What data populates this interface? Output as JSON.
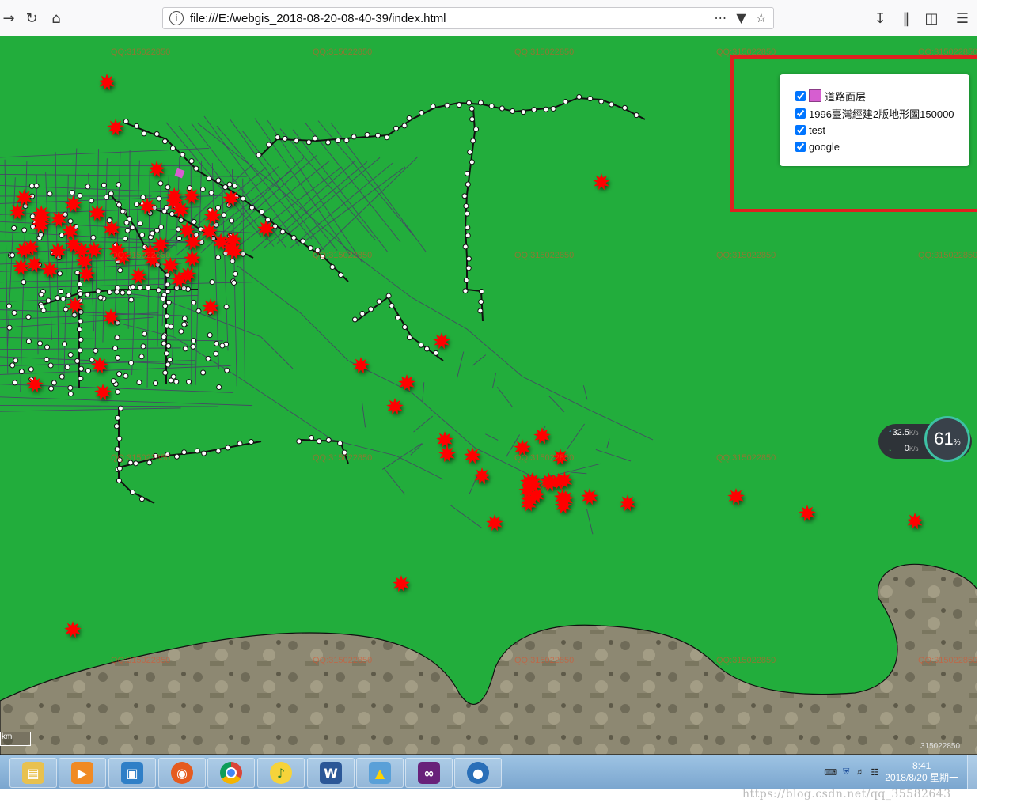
{
  "browser": {
    "url": "file:///E:/webgis_2018-08-20-08-40-39/index.html",
    "nav_icons": [
      "forward-arrow-icon",
      "reload-icon",
      "home-icon"
    ],
    "url_actions": [
      "more-icon",
      "pocket-icon",
      "bookmark-star-icon"
    ],
    "right_icons": [
      "download-icon",
      "library-icon",
      "sidebar-icon",
      "menu-icon"
    ]
  },
  "layer_panel": {
    "items": [
      {
        "label": "道路面层",
        "checked": true,
        "swatch": "#d65ed0"
      },
      {
        "label": "1996臺灣經建2版地形圖150000",
        "checked": true
      },
      {
        "label": "test",
        "checked": true
      },
      {
        "label": "google",
        "checked": true
      }
    ]
  },
  "map": {
    "background_color": "#22ad3c",
    "marker_color": "#ff0000",
    "watermark_text": "QQ:315022850",
    "scale_label": "km",
    "attribution": "315022850"
  },
  "net_widget": {
    "upload": "32.5",
    "upload_unit": "K/s",
    "download": "0",
    "download_unit": "K/s",
    "percent": "61",
    "percent_unit": "%"
  },
  "taskbar": {
    "apps": [
      {
        "name": "file-explorer",
        "icon": "folder-icon"
      },
      {
        "name": "media-player",
        "icon": "media-play-icon"
      },
      {
        "name": "photo-viewer",
        "icon": "window-icon"
      },
      {
        "name": "firefox",
        "icon": "firefox-icon"
      },
      {
        "name": "chrome",
        "icon": "chrome-icon"
      },
      {
        "name": "music",
        "icon": "music-icon"
      },
      {
        "name": "word",
        "icon": "word-icon"
      },
      {
        "name": "arcgis",
        "icon": "globe-tool-icon"
      },
      {
        "name": "visual-studio",
        "icon": "visual-studio-icon"
      },
      {
        "name": "earth",
        "icon": "earth-icon"
      }
    ],
    "time": "8:41",
    "date": "2018/8/20 星期一"
  },
  "blog_url": "https://blog.csdn.net/qq_35582643"
}
